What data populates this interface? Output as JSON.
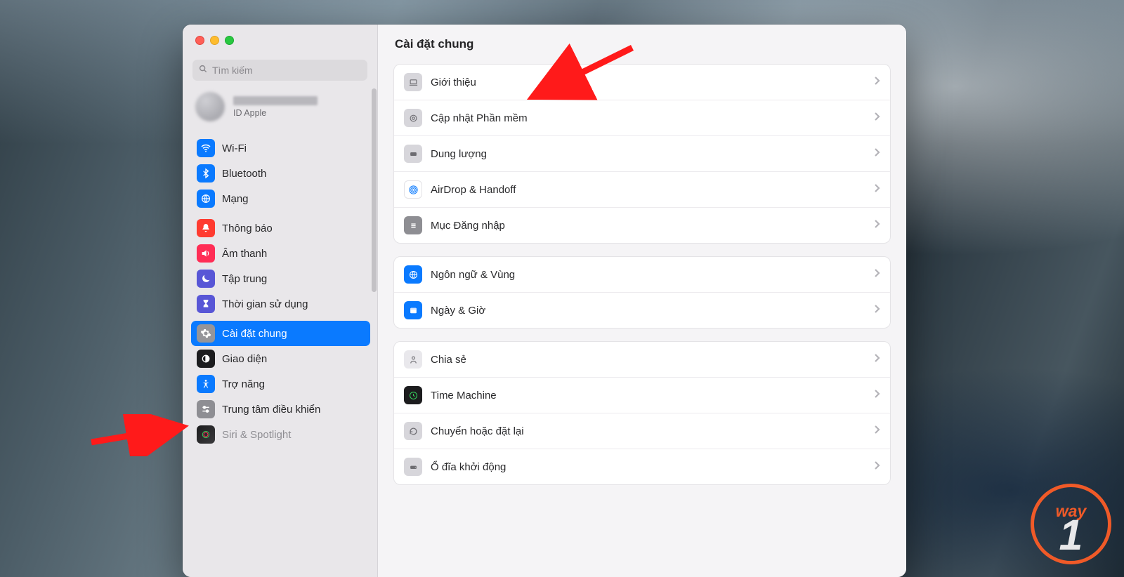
{
  "search": {
    "placeholder": "Tìm kiếm"
  },
  "account": {
    "subtitle": "ID Apple"
  },
  "sidebar": {
    "items": [
      {
        "label": "Wi-Fi"
      },
      {
        "label": "Bluetooth"
      },
      {
        "label": "Mạng"
      },
      {
        "label": "Thông báo"
      },
      {
        "label": "Âm thanh"
      },
      {
        "label": "Tập trung"
      },
      {
        "label": "Thời gian sử dụng"
      },
      {
        "label": "Cài đặt chung",
        "selected": true
      },
      {
        "label": "Giao diện"
      },
      {
        "label": "Trợ năng"
      },
      {
        "label": "Trung tâm điều khiển"
      },
      {
        "label": "Siri & Spotlight"
      }
    ]
  },
  "main": {
    "title": "Cài đặt chung",
    "groups": [
      [
        {
          "label": "Giới thiệu",
          "icon": "about"
        },
        {
          "label": "Cập nhật Phần mềm",
          "icon": "update"
        },
        {
          "label": "Dung lượng",
          "icon": "storage"
        },
        {
          "label": "AirDrop & Handoff",
          "icon": "airdrop"
        },
        {
          "label": "Mục Đăng nhập",
          "icon": "login-items"
        }
      ],
      [
        {
          "label": "Ngôn ngữ & Vùng",
          "icon": "language"
        },
        {
          "label": "Ngày & Giờ",
          "icon": "datetime"
        }
      ],
      [
        {
          "label": "Chia sẻ",
          "icon": "sharing"
        },
        {
          "label": "Time Machine",
          "icon": "timemachine"
        },
        {
          "label": "Chuyển hoặc đặt lại",
          "icon": "reset"
        },
        {
          "label": "Ổ đĩa khởi động",
          "icon": "startupdisk"
        }
      ]
    ]
  },
  "watermark": {
    "text_top": "way",
    "text_digit": "1"
  }
}
